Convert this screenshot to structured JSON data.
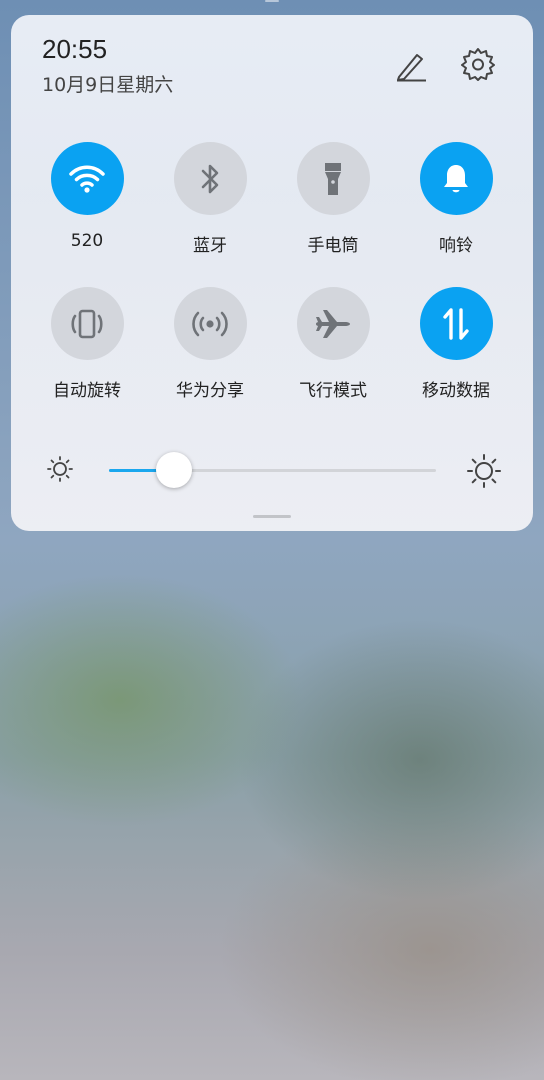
{
  "header": {
    "time": "20:55",
    "date": "10月9日星期六"
  },
  "toggles": [
    {
      "label": "520",
      "state": "on",
      "icon": "wifi-icon"
    },
    {
      "label": "蓝牙",
      "state": "off",
      "icon": "bluetooth-icon"
    },
    {
      "label": "手电筒",
      "state": "off",
      "icon": "flashlight-icon"
    },
    {
      "label": "响铃",
      "state": "on",
      "icon": "bell-icon"
    },
    {
      "label": "自动旋转",
      "state": "off",
      "icon": "rotate-icon"
    },
    {
      "label": "华为分享",
      "state": "off",
      "icon": "share-signal-icon"
    },
    {
      "label": "飞行模式",
      "state": "off",
      "icon": "airplane-icon"
    },
    {
      "label": "移动数据",
      "state": "on",
      "icon": "mobile-data-icon"
    }
  ],
  "brightness": {
    "level": 0.2
  },
  "colors": {
    "accent": "#0aa2f2",
    "inactive": "#d3d6dc",
    "icon_inactive": "#6f7378"
  }
}
